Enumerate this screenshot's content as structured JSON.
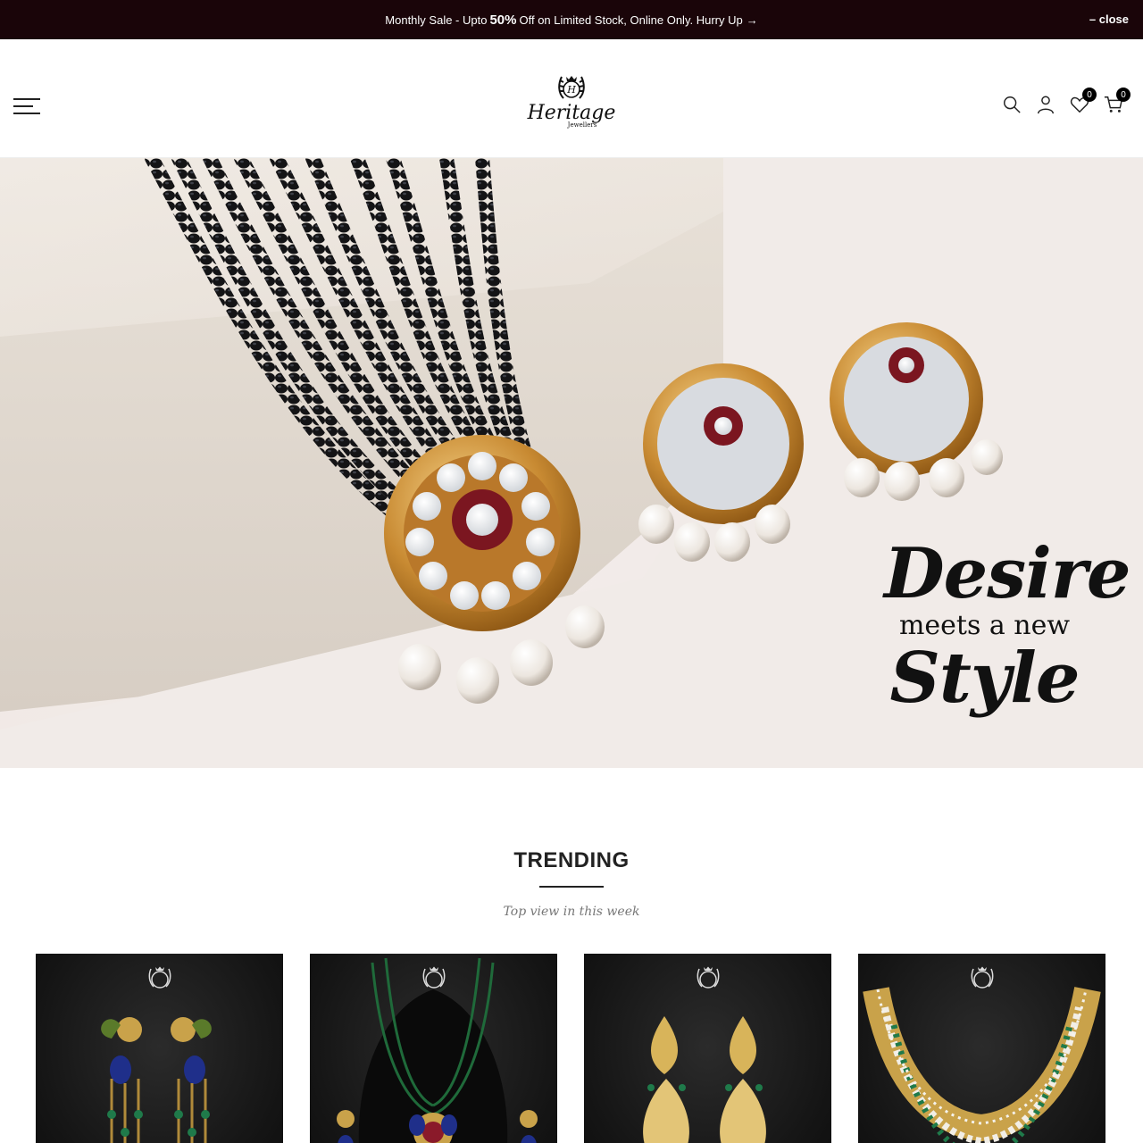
{
  "announcement": {
    "text_before": "Monthly Sale - Upto",
    "highlight": "50%",
    "text_after": "Off on Limited Stock, Online Only. Hurry Up",
    "arrow": "→",
    "close_label": "– close",
    "background": "#1a0509"
  },
  "header": {
    "menu_icon": "hamburger-icon",
    "logo": {
      "brand": "Heritage",
      "sub": "Jewellers",
      "mark": "H"
    },
    "icons": [
      {
        "name": "search-icon"
      },
      {
        "name": "account-icon"
      },
      {
        "name": "wishlist-icon",
        "count": "0"
      },
      {
        "name": "cart-icon",
        "count": "0"
      }
    ]
  },
  "hero": {
    "line1": "Desire",
    "line2": "meets a new",
    "line3": "Style"
  },
  "trending": {
    "title": "TRENDING",
    "subtitle": "Top view in this week"
  },
  "products": [
    {
      "name": "peacock-earrings"
    },
    {
      "name": "peacock-necklace-set"
    },
    {
      "name": "kundan-drop-earrings"
    },
    {
      "name": "pearl-emerald-choker"
    }
  ]
}
